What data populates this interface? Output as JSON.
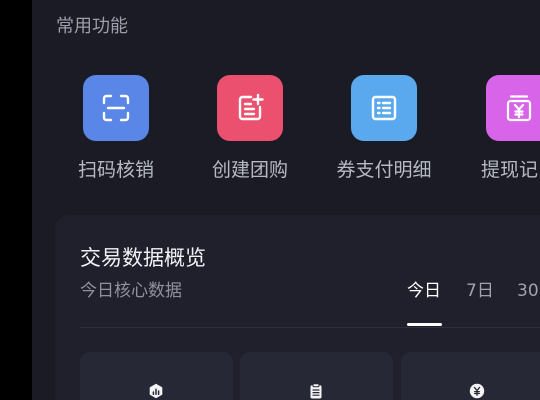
{
  "section": {
    "title": "常用功能"
  },
  "shortcuts": [
    {
      "label": "扫码核销",
      "icon": "scan-icon",
      "color": "#5a86e8"
    },
    {
      "label": "创建团购",
      "icon": "document-plus-icon",
      "color": "#ec506f"
    },
    {
      "label": "券支付明细",
      "icon": "list-icon",
      "color": "#5aa9ef"
    },
    {
      "label": "提现记",
      "icon": "yen-card-icon",
      "color": "#d865e9"
    }
  ],
  "overview": {
    "title": "交易数据概览",
    "subtitle": "今日核心数据",
    "tabs": [
      {
        "label": "今日",
        "active": true
      },
      {
        "label": "7日",
        "active": false
      },
      {
        "label": "30",
        "active": false
      }
    ],
    "stats": [
      {
        "icon": "bar-chart-hexagon-icon"
      },
      {
        "icon": "clipboard-icon"
      },
      {
        "icon": "yen-circle-icon"
      }
    ]
  },
  "theme": {
    "background": "#1a1b25",
    "card": "#1f202c",
    "stat_card": "#272836",
    "text_primary": "#f2f2f5",
    "text_secondary": "#8f919d"
  }
}
